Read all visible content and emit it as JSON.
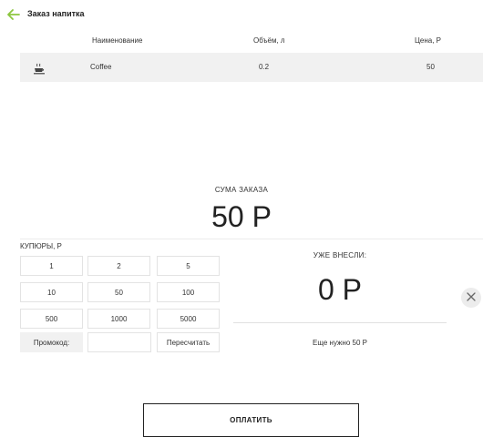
{
  "header": {
    "title": "Заказ напитка",
    "back_icon": "arrow-left-icon",
    "accent": "#8cc63f"
  },
  "table": {
    "columns": [
      "Наименование",
      "Объём, л",
      "Цена, Р"
    ],
    "rows": [
      {
        "icon": "coffee-cup-icon",
        "name": "Coffee",
        "volume": "0.2",
        "price": "50"
      }
    ]
  },
  "sum": {
    "label": "СУМА ЗАКАЗА",
    "value": "50 Р"
  },
  "bills": {
    "label": "КУПЮРЫ, Р",
    "values": [
      "1",
      "2",
      "5",
      "10",
      "50",
      "100",
      "500",
      "1000",
      "5000"
    ],
    "promo_label": "Промокод:",
    "promo_value": "",
    "recalc_label": "Пересчитать"
  },
  "paid": {
    "label": "УЖЕ ВНЕСЛИ:",
    "value": "0 Р",
    "need_text": "Еще нужно 50 Р"
  },
  "close_icon": "close-icon",
  "pay_button": "ОПЛАТИТЬ"
}
